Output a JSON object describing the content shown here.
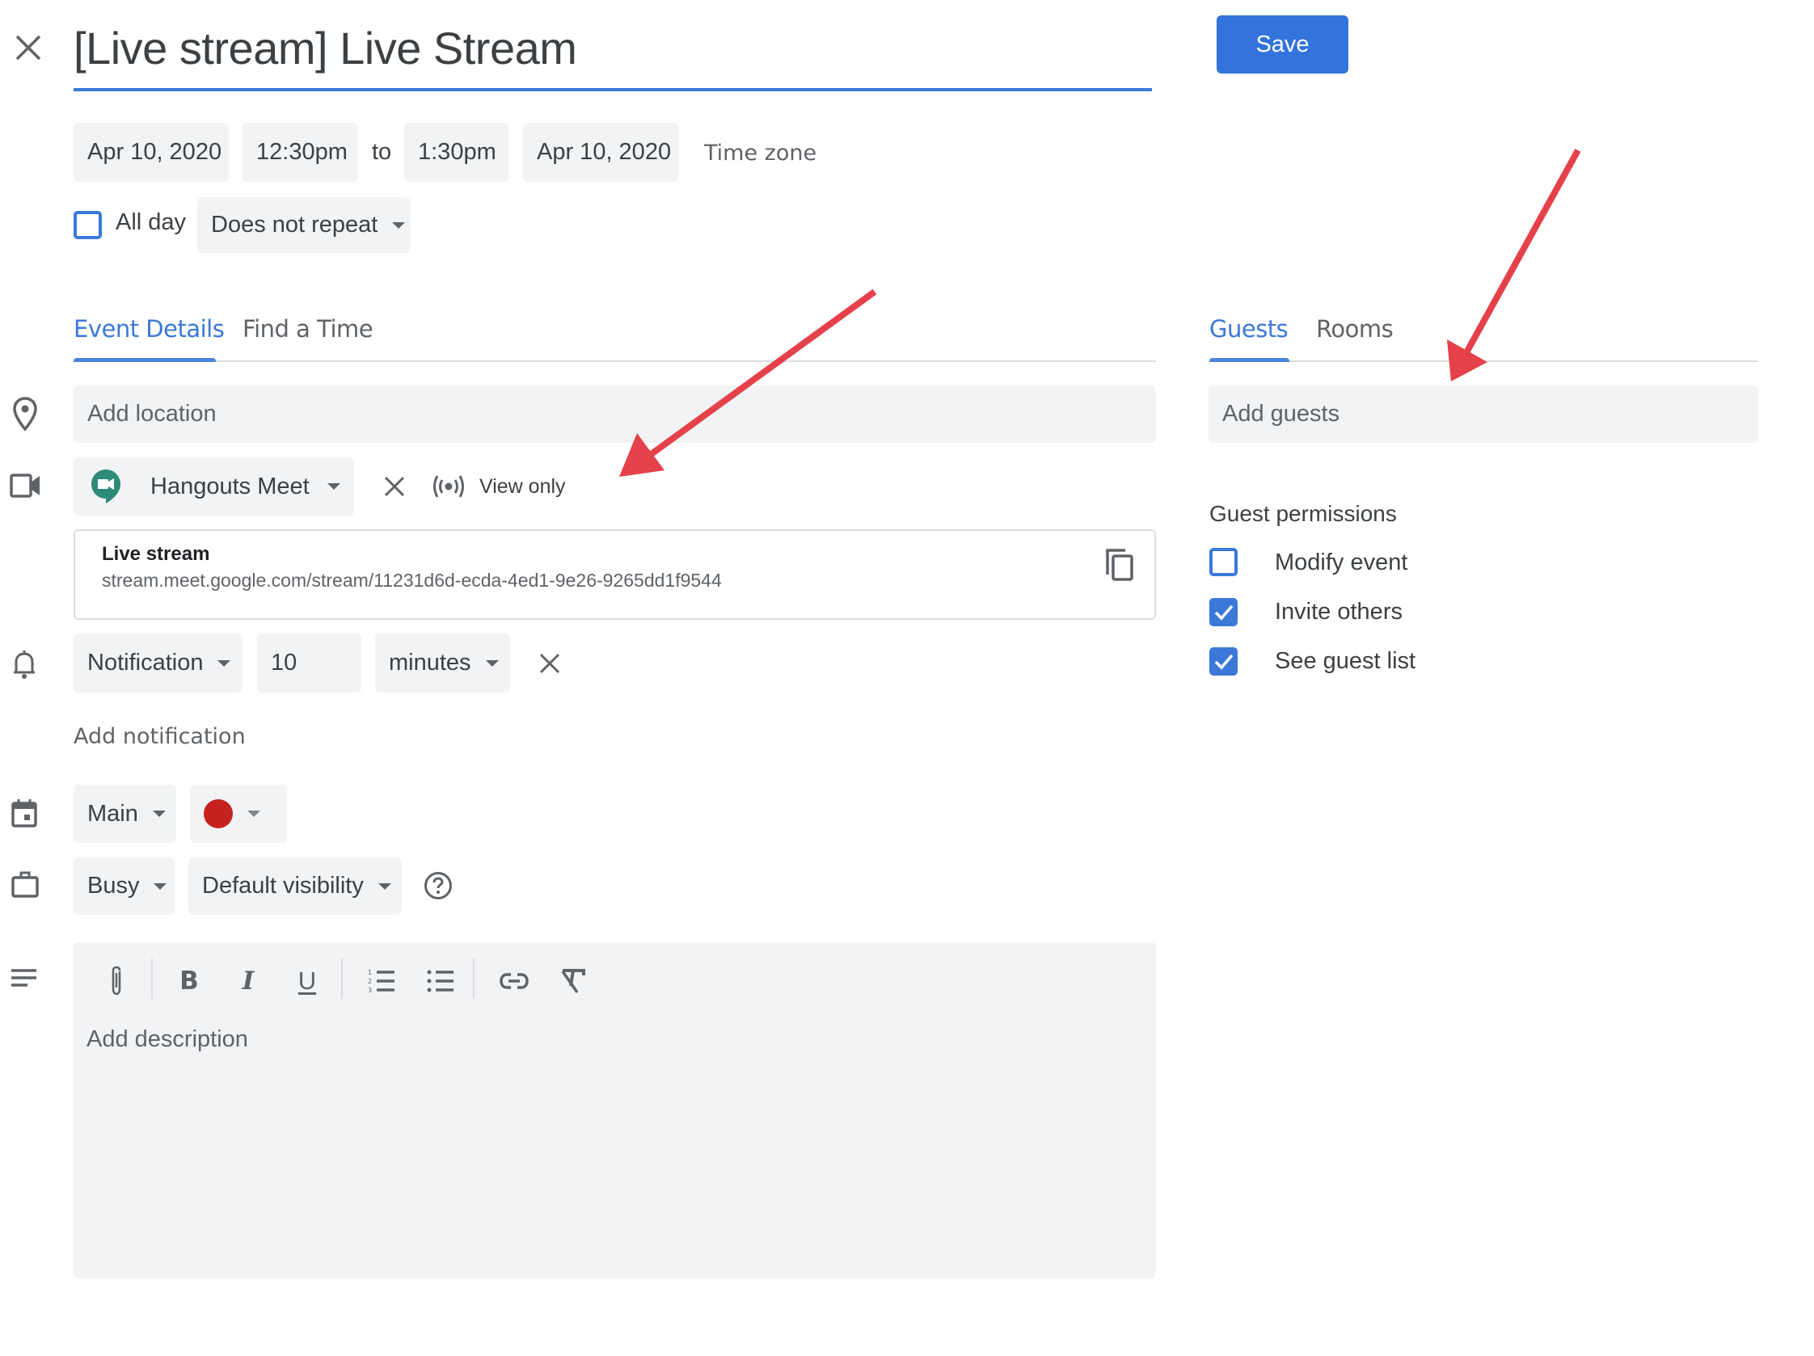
{
  "header": {
    "close_icon": "close-icon",
    "title": "[Live stream] Live Stream",
    "save_label": "Save"
  },
  "datetime": {
    "start_date": "Apr 10, 2020",
    "start_time": "12:30pm",
    "to_label": "to",
    "end_time": "1:30pm",
    "end_date": "Apr 10, 2020",
    "timezone_label": "Time zone",
    "all_day_label": "All day",
    "all_day_checked": false,
    "repeat_value": "Does not repeat"
  },
  "left_tabs": [
    {
      "label": "Event Details",
      "active": true
    },
    {
      "label": "Find a Time",
      "active": false
    }
  ],
  "right_tabs": [
    {
      "label": "Guests",
      "active": true
    },
    {
      "label": "Rooms",
      "active": false
    }
  ],
  "location": {
    "icon": "location-pin-icon",
    "placeholder": "Add location"
  },
  "conference": {
    "icon": "video-camera-icon",
    "provider": "Hangouts Meet",
    "view_only_label": "View only",
    "live_stream_title": "Live stream",
    "live_stream_url": "stream.meet.google.com/stream/11231d6d-ecda-4ed1-9e26-9265dd1f9544"
  },
  "notification": {
    "icon": "bell-icon",
    "type": "Notification",
    "amount": "10",
    "unit": "minutes",
    "add_label": "Add notification"
  },
  "calendar": {
    "icon": "calendar-icon",
    "name": "Main",
    "color": "#c5221f"
  },
  "availability": {
    "icon": "briefcase-icon",
    "status": "Busy",
    "visibility": "Default visibility"
  },
  "description": {
    "icon": "notes-icon",
    "placeholder": "Add description",
    "toolbar": [
      "attachment",
      "bold",
      "italic",
      "underline",
      "numbered-list",
      "bulleted-list",
      "link",
      "clear-formatting"
    ]
  },
  "guests": {
    "placeholder": "Add guests",
    "permissions_title": "Guest permissions",
    "permissions": [
      {
        "label": "Modify event",
        "checked": false
      },
      {
        "label": "Invite others",
        "checked": true
      },
      {
        "label": "See guest list",
        "checked": true
      }
    ]
  },
  "colors": {
    "accent": "#3b78d8",
    "save_button": "#3273dc",
    "annotation_arrow": "#e5414a"
  }
}
